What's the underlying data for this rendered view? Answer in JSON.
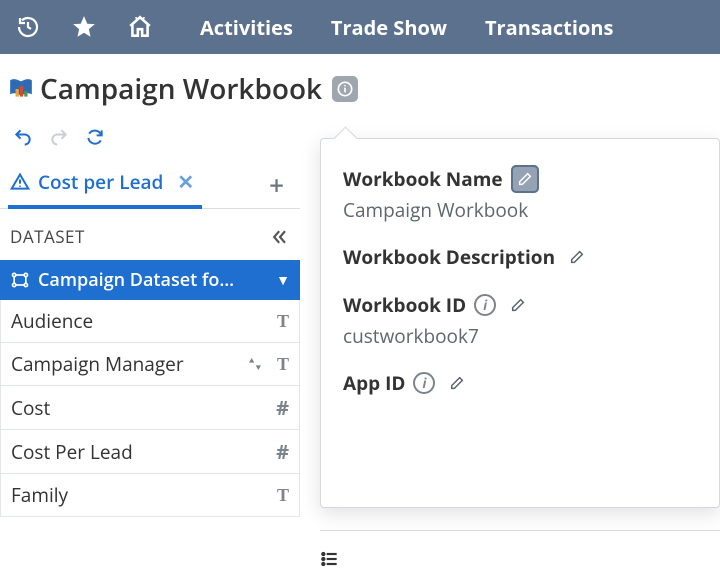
{
  "nav": {
    "links": [
      "Activities",
      "Trade Show",
      "Transactions"
    ]
  },
  "title": "Campaign Workbook",
  "tab": {
    "label": "Cost per Lead"
  },
  "dataset": {
    "heading": "DATASET",
    "selected": "Campaign Dataset fo…",
    "fields": [
      {
        "name": "Audience",
        "type": "T",
        "sort": false
      },
      {
        "name": "Campaign Manager",
        "type": "T",
        "sort": true
      },
      {
        "name": "Cost",
        "type": "#",
        "sort": false
      },
      {
        "name": "Cost Per Lead",
        "type": "#",
        "sort": false
      },
      {
        "name": "Family",
        "type": "T",
        "sort": false
      }
    ]
  },
  "popover": {
    "name_label": "Workbook Name",
    "name_value": "Campaign Workbook",
    "desc_label": "Workbook Description",
    "id_label": "Workbook ID",
    "id_value": "custworkbook7",
    "appid_label": "App ID"
  }
}
